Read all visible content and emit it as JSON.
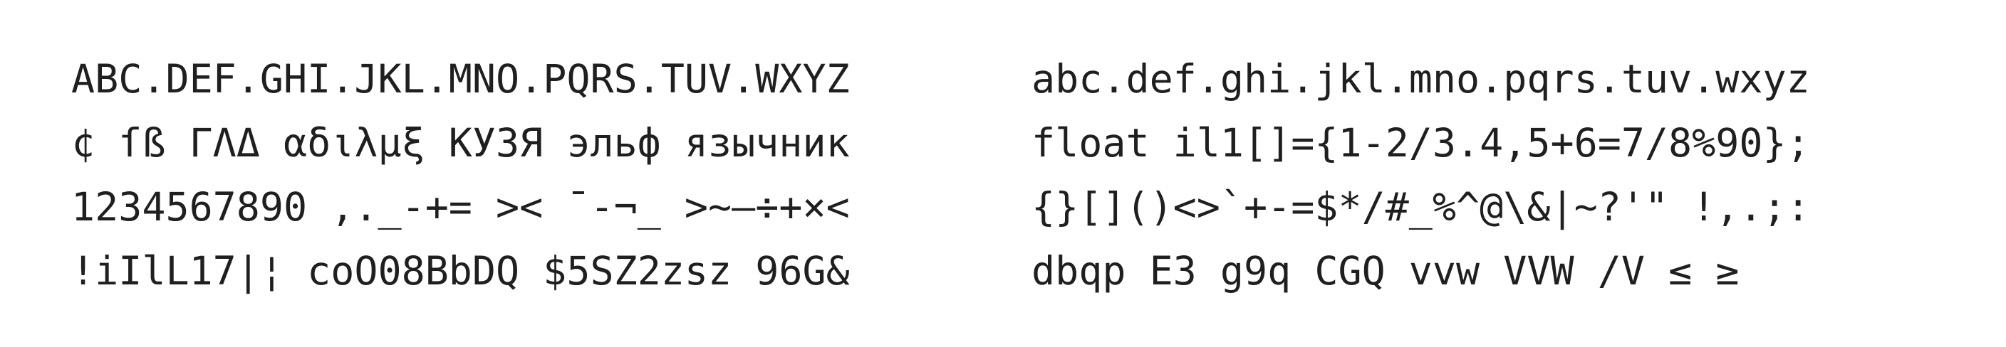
{
  "colors": {
    "background": "#ffffff",
    "text": "#1f1f1f"
  },
  "specimen": {
    "left": [
      "ABC.DEF.GHI.JKL.MNO.PQRS.TUV.WXYZ",
      "¢ ſß ΓΛΔ αδιλμξ КУЗЯ эльф язычник",
      "1234567890 ,._-+= >< ¯-¬_ >~–÷+×<",
      "!iIlL17|¦ coO08BbDQ $5SZ2zsz 96G&"
    ],
    "right": [
      "abc.def.ghi.jkl.mno.pqrs.tuv.wxyz",
      "float il1[]={1-2/3.4,5+6=7/8%90};",
      "{}[]()<>`+-=$*/#_%^@\\&|~?'\" !,.;:",
      "dbqp E3 g9q CGQ vvw VVW /V ≤ ≥"
    ]
  }
}
